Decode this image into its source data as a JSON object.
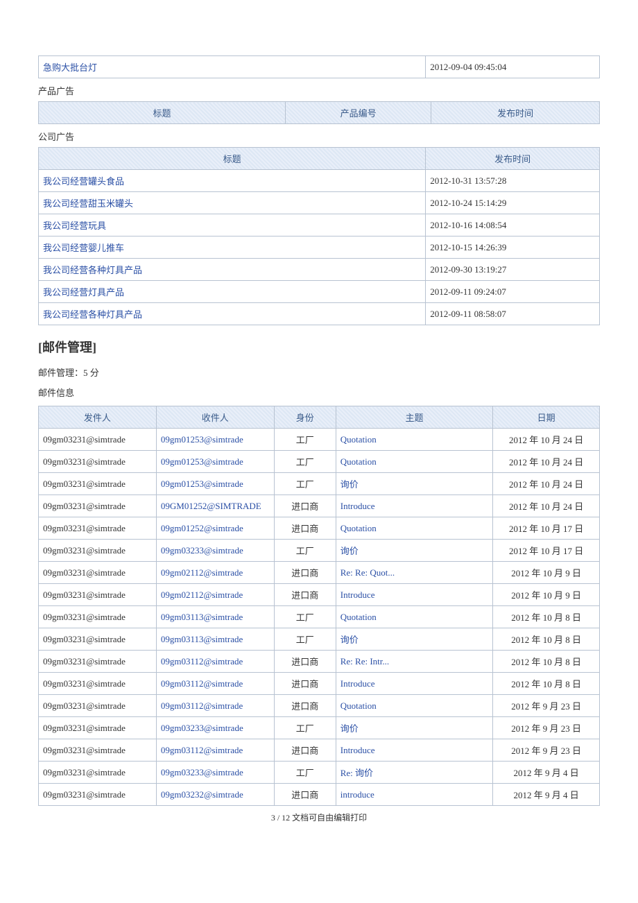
{
  "top_row": {
    "title": "急购大批台灯",
    "time": "2012-09-04 09:45:04"
  },
  "product_ad": {
    "label": "产品广告",
    "headers": {
      "title": "标题",
      "code": "产品编号",
      "time": "发布时间"
    }
  },
  "company_ad": {
    "label": "公司广告",
    "headers": {
      "title": "标题",
      "time": "发布时间"
    },
    "rows": [
      {
        "title": "我公司经营罐头食品",
        "time": "2012-10-31 13:57:28"
      },
      {
        "title": "我公司经营甜玉米罐头",
        "time": "2012-10-24 15:14:29"
      },
      {
        "title": "我公司经营玩具",
        "time": "2012-10-16 14:08:54"
      },
      {
        "title": "我公司经营婴儿推车",
        "time": "2012-10-15 14:26:39"
      },
      {
        "title": "我公司经营各种灯具产品",
        "time": "2012-09-30 13:19:27"
      },
      {
        "title": "我公司经营灯具产品",
        "time": "2012-09-11 09:24:07"
      },
      {
        "title": "我公司经营各种灯具产品",
        "time": "2012-09-11 08:58:07"
      }
    ]
  },
  "mail": {
    "section_title": "[邮件管理]",
    "score_label": "邮件管理：5 分",
    "info_label": "邮件信息",
    "headers": {
      "from": "发件人",
      "to": "收件人",
      "role": "身份",
      "subject": "主题",
      "date": "日期"
    },
    "rows": [
      {
        "from": "09gm03231@simtrade",
        "to": "09gm01253@simtrade",
        "role": "工厂",
        "subject": "Quotation",
        "date": "2012 年 10 月 24 日"
      },
      {
        "from": "09gm03231@simtrade",
        "to": "09gm01253@simtrade",
        "role": "工厂",
        "subject": "Quotation",
        "date": "2012 年 10 月 24 日"
      },
      {
        "from": "09gm03231@simtrade",
        "to": "09gm01253@simtrade",
        "role": "工厂",
        "subject": "询价",
        "date": "2012 年 10 月 24 日"
      },
      {
        "from": "09gm03231@simtrade",
        "to": "09GM01252@SIMTRADE",
        "role": "进口商",
        "subject": "Introduce",
        "date": "2012 年 10 月 24 日"
      },
      {
        "from": "09gm03231@simtrade",
        "to": "09gm01252@simtrade",
        "role": "进口商",
        "subject": "Quotation",
        "date": "2012 年 10 月 17 日"
      },
      {
        "from": "09gm03231@simtrade",
        "to": "09gm03233@simtrade",
        "role": "工厂",
        "subject": "询价",
        "date": "2012 年 10 月 17 日"
      },
      {
        "from": "09gm03231@simtrade",
        "to": "09gm02112@simtrade",
        "role": "进口商",
        "subject": "Re: Re: Quot...",
        "date": "2012 年 10 月 9 日"
      },
      {
        "from": "09gm03231@simtrade",
        "to": "09gm02112@simtrade",
        "role": "进口商",
        "subject": "Introduce",
        "date": "2012 年 10 月 9 日"
      },
      {
        "from": "09gm03231@simtrade",
        "to": "09gm03113@simtrade",
        "role": "工厂",
        "subject": "Quotation",
        "date": "2012 年 10 月 8 日"
      },
      {
        "from": "09gm03231@simtrade",
        "to": "09gm03113@simtrade",
        "role": "工厂",
        "subject": "询价",
        "date": "2012 年 10 月 8 日"
      },
      {
        "from": "09gm03231@simtrade",
        "to": "09gm03112@simtrade",
        "role": "进口商",
        "subject": "Re: Re: Intr...",
        "date": "2012 年 10 月 8 日"
      },
      {
        "from": "09gm03231@simtrade",
        "to": "09gm03112@simtrade",
        "role": "进口商",
        "subject": "Introduce",
        "date": "2012 年 10 月 8 日"
      },
      {
        "from": "09gm03231@simtrade",
        "to": "09gm03112@simtrade",
        "role": "进口商",
        "subject": "Quotation",
        "date": "2012 年 9 月 23 日"
      },
      {
        "from": "09gm03231@simtrade",
        "to": "09gm03233@simtrade",
        "role": "工厂",
        "subject": "询价",
        "date": "2012 年 9 月 23 日"
      },
      {
        "from": "09gm03231@simtrade",
        "to": "09gm03112@simtrade",
        "role": "进口商",
        "subject": "Introduce",
        "date": "2012 年 9 月 23 日"
      },
      {
        "from": "09gm03231@simtrade",
        "to": "09gm03233@simtrade",
        "role": "工厂",
        "subject": "Re: 询价",
        "date": "2012 年 9 月 4 日"
      },
      {
        "from": "09gm03231@simtrade",
        "to": "09gm03232@simtrade",
        "role": "进口商",
        "subject": "introduce",
        "date": "2012 年 9 月 4 日"
      }
    ]
  },
  "footer": "3 / 12 文档可自由编辑打印"
}
